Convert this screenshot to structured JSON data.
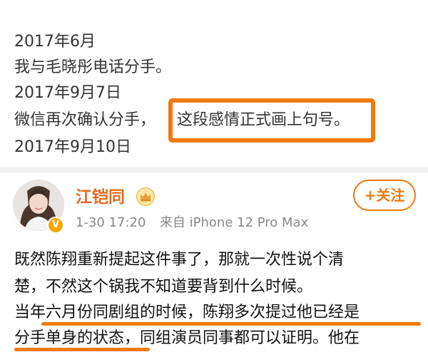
{
  "timeline": {
    "lines": [
      "2017年6月",
      "我与毛晓彤电话分手。",
      "2017年9月7日",
      "微信再次确认分手，",
      "2017年9月10日"
    ],
    "highlighted": "这段感情正式画上句号。"
  },
  "post": {
    "username": "江铠同",
    "timestamp": "1-30 17:20",
    "source": "来自 iPhone 12 Pro Max",
    "follow_label": "+关注",
    "body_lines": [
      "既然陈翔重新提起这件事了，那就一次性说个清",
      "楚，不然这个锅我不知道要背到什么时候。",
      "当年六月份同剧组的时候，陈翔多次提过他已经是",
      "分手单身的状态，同组演员同事都可以证明。他在"
    ]
  },
  "colors": {
    "accent": "#f07a10",
    "username": "#e86b1f",
    "meta": "#888888",
    "verify": "#f6a800"
  },
  "icons": {
    "verified": "verified-badge-icon",
    "vip": "crown-icon"
  }
}
